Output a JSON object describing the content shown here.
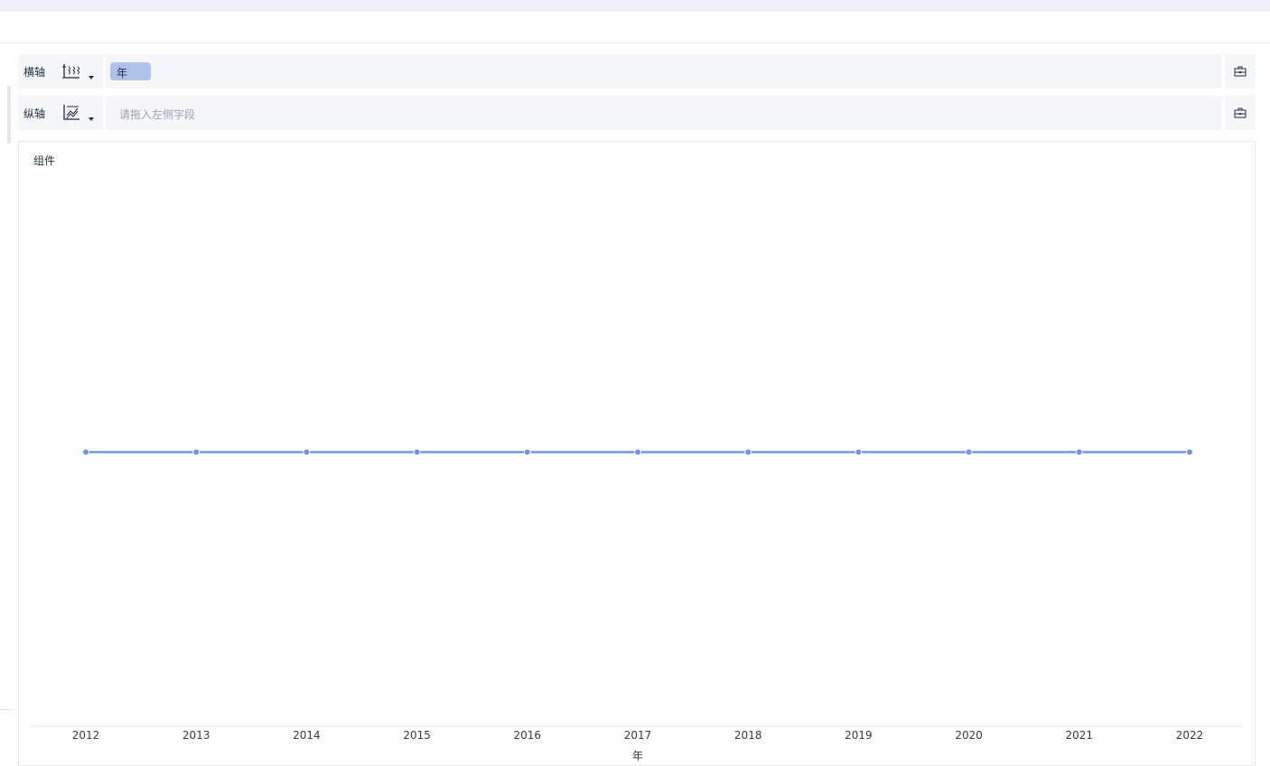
{
  "axes": {
    "x_label": "横轴",
    "y_label": "纵轴",
    "x_field": "年",
    "y_placeholder": "请拖入左侧字段",
    "x_icon": "horizontal-axis-icon",
    "y_icon": "vertical-axis-icon",
    "tool_icon": "toolbox-icon"
  },
  "panel": {
    "title": "组件"
  },
  "colors": {
    "line": "#7393e6",
    "pill": "#aec2ec",
    "zone_bg": "#f5f7fa"
  },
  "chart_data": {
    "type": "line",
    "categories": [
      "2012",
      "2013",
      "2014",
      "2015",
      "2016",
      "2017",
      "2018",
      "2019",
      "2020",
      "2021",
      "2022"
    ],
    "values": [
      1,
      1,
      1,
      1,
      1,
      1,
      1,
      1,
      1,
      1,
      1
    ],
    "xlabel": "年",
    "ylabel": "",
    "ylim": [
      0,
      2
    ],
    "grid": false,
    "legend": "none"
  }
}
